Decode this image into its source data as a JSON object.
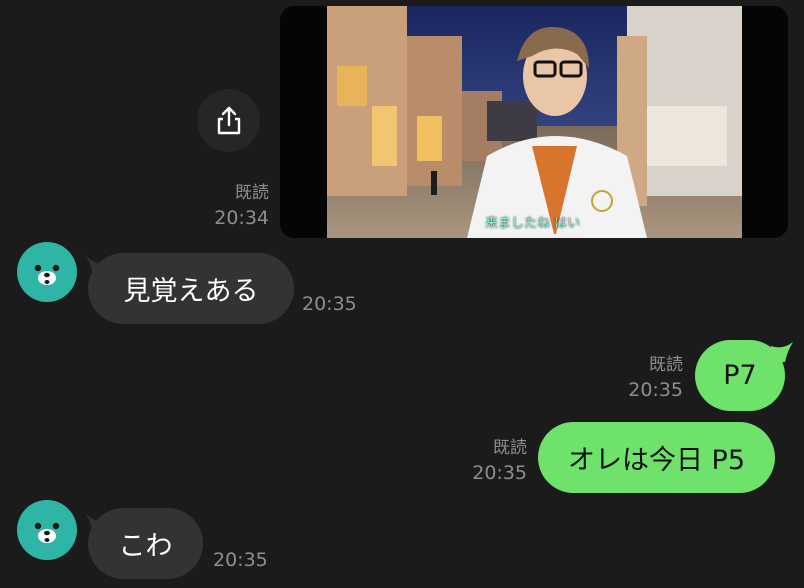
{
  "video_message": {
    "read_label": "既読",
    "time": "20:34",
    "caption": "来ましたね はい"
  },
  "messages": [
    {
      "direction": "incoming",
      "text": "見覚えある",
      "time": "20:35"
    },
    {
      "direction": "outgoing",
      "text": "P7",
      "read_label": "既読",
      "time": "20:35"
    },
    {
      "direction": "outgoing",
      "text": "オレは今日 P5",
      "read_label": "既読",
      "time": "20:35"
    },
    {
      "direction": "incoming",
      "text": "こわ",
      "time": "20:35"
    }
  ],
  "icons": {
    "share": "share-icon",
    "avatar": "bear-avatar"
  },
  "colors": {
    "background": "#1b1b1b",
    "incoming_bubble": "#333333",
    "outgoing_bubble": "#6ee26a",
    "avatar": "#2fb5a6",
    "meta_text": "#8e8e8e"
  }
}
